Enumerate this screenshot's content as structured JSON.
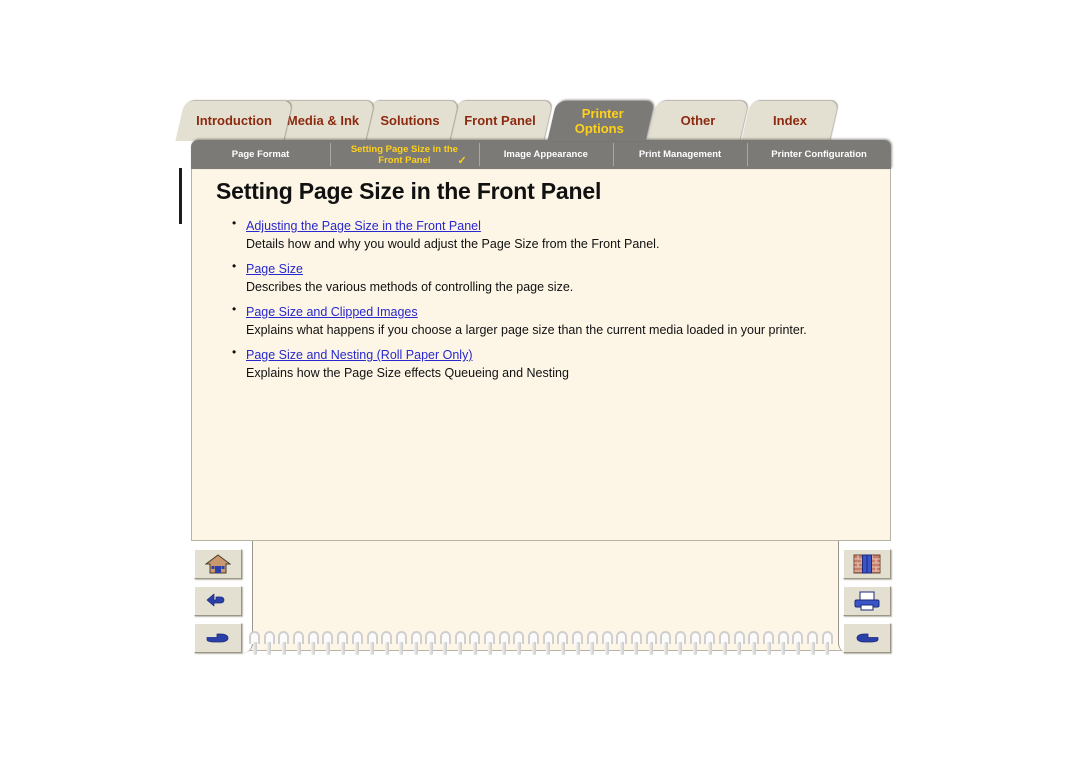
{
  "main_tabs": [
    {
      "label": "Introduction",
      "name": "tab-introduction",
      "active": false,
      "lines": [
        "Introduction"
      ]
    },
    {
      "label": "Media & Ink",
      "name": "tab-media-and-ink",
      "active": false,
      "lines": [
        "Media & Ink"
      ]
    },
    {
      "label": "Solutions",
      "name": "tab-solutions",
      "active": false,
      "lines": [
        "Solutions"
      ]
    },
    {
      "label": "Front Panel",
      "name": "tab-front-panel",
      "active": false,
      "lines": [
        "Front Panel"
      ]
    },
    {
      "label": "Printer Options",
      "name": "tab-printer-options",
      "active": true,
      "lines": [
        "Printer",
        "Options"
      ]
    },
    {
      "label": "Other",
      "name": "tab-other",
      "active": false,
      "lines": [
        "Other"
      ]
    },
    {
      "label": "Index",
      "name": "tab-index",
      "active": false,
      "lines": [
        "Index"
      ]
    }
  ],
  "sub_tabs": [
    {
      "label": "Page Format",
      "name": "subtab-page-format",
      "active": false,
      "lines": [
        "Page Format"
      ],
      "check": ""
    },
    {
      "label": "Setting Page Size in the Front Panel",
      "name": "subtab-setting-page-size",
      "active": true,
      "lines": [
        "Setting Page Size in the",
        "Front Panel"
      ],
      "check": "✓"
    },
    {
      "label": "Image Appearance",
      "name": "subtab-image-appearance",
      "active": false,
      "lines": [
        "Image Appearance"
      ],
      "check": ""
    },
    {
      "label": "Print Management",
      "name": "subtab-print-management",
      "active": false,
      "lines": [
        "Print Management"
      ],
      "check": ""
    },
    {
      "label": "Printer Configuration",
      "name": "subtab-printer-configuration",
      "active": false,
      "lines": [
        "Printer Configuration"
      ],
      "check": ""
    }
  ],
  "page": {
    "title": "Setting Page Size in the Front Panel",
    "links": [
      {
        "link": "Adjusting the Page Size in the Front Panel",
        "description": "Details how and why you would adjust the Page Size from the Front Panel."
      },
      {
        "link": "Page Size",
        "description": "Describes the various methods of controlling the page size."
      },
      {
        "link": "Page Size and Clipped Images",
        "description": "Explains what happens if you choose a larger page size than the current media loaded in your printer."
      },
      {
        "link": "Page Size and Nesting (Roll Paper Only)",
        "description": "Explains how the Page Size effects Queueing and Nesting"
      }
    ]
  },
  "nav_left": [
    {
      "icon": "home-icon",
      "name": "nav-home-button"
    },
    {
      "icon": "back-arrow-icon",
      "name": "nav-back-button"
    },
    {
      "icon": "hand-right-icon",
      "name": "nav-next-button"
    }
  ],
  "nav_right": [
    {
      "icon": "bookshelf-icon",
      "name": "nav-bookshelf-button"
    },
    {
      "icon": "printer-icon",
      "name": "nav-print-button"
    },
    {
      "icon": "hand-left-icon",
      "name": "nav-previous-button"
    }
  ],
  "colors": {
    "tab_inactive_bg": "#e4e0d1",
    "tab_inactive_text": "#8c2a10",
    "tab_active_bg": "#7c7a77",
    "tab_active_text": "#ffd11a",
    "page_bg": "#fdf6e7",
    "link_color": "#2828cc",
    "body_text": "#111111"
  },
  "spiral": {
    "coil_count": 40
  }
}
